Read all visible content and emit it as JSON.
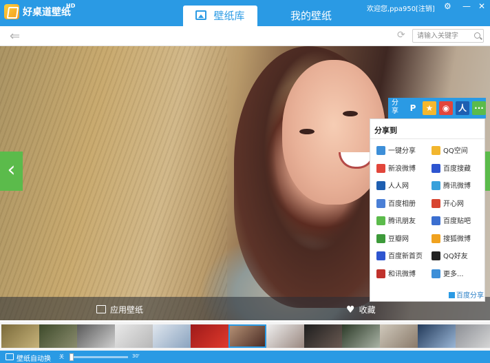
{
  "app": {
    "title": "好桌道壁纸",
    "badge": "HD",
    "welcome": "欢迎您,ppa950",
    "logout": "[注销]",
    "settings_icon": "gear-icon",
    "minimize_icon": "minimize-icon",
    "close_icon": "close-icon"
  },
  "tabs": [
    {
      "label": "壁纸库",
      "active": true,
      "icon": "picture-icon"
    },
    {
      "label": "我的壁纸",
      "active": false
    }
  ],
  "toolbar": {
    "back_icon": "arrow-left-icon",
    "refresh_icon": "refresh-icon",
    "search_placeholder": "请输入关键字",
    "search_icon": "search-icon"
  },
  "viewer": {
    "prev_icon": "chevron-left-icon",
    "apply_label": "应用壁纸",
    "favorite_label": "收藏"
  },
  "share": {
    "bar_label": "分享",
    "bar_icons": [
      {
        "name": "tencent-weibo-icon",
        "color": "#2a9ae4",
        "glyph": "P"
      },
      {
        "name": "qzone-icon",
        "color": "#f5b72d",
        "glyph": "★"
      },
      {
        "name": "sina-weibo-icon",
        "color": "#e2463b",
        "glyph": "◉"
      },
      {
        "name": "renren-icon",
        "color": "#1e5fb1",
        "glyph": "人"
      },
      {
        "name": "more-icon",
        "color": "#5bbb4b",
        "glyph": "···"
      }
    ],
    "panel_title": "分享到",
    "items": [
      {
        "label": "一键分享",
        "color": "#3d8fd8"
      },
      {
        "label": "QQ空间",
        "color": "#f2b62e"
      },
      {
        "label": "新浪微博",
        "color": "#e2463b"
      },
      {
        "label": "百度搜藏",
        "color": "#2e55d0"
      },
      {
        "label": "人人网",
        "color": "#1e5fb1"
      },
      {
        "label": "腾讯微博",
        "color": "#38a1db"
      },
      {
        "label": "百度相册",
        "color": "#4a7fd6"
      },
      {
        "label": "开心网",
        "color": "#d8442f"
      },
      {
        "label": "腾讯朋友",
        "color": "#5bbb4b"
      },
      {
        "label": "百度贴吧",
        "color": "#3b6fd0"
      },
      {
        "label": "豆瓣网",
        "color": "#3d9a3a"
      },
      {
        "label": "搜狐微博",
        "color": "#f0a21f"
      },
      {
        "label": "百度新首页",
        "color": "#2e55d0"
      },
      {
        "label": "QQ好友",
        "color": "#222222"
      },
      {
        "label": "和讯微博",
        "color": "#c0322c"
      },
      {
        "label": "更多...",
        "color": "#3d8fd8"
      }
    ],
    "footer": "百度分享"
  },
  "thumbnails": [
    {
      "colors": [
        "#7a6a3a",
        "#c7b37a"
      ]
    },
    {
      "colors": [
        "#3d4a2a",
        "#8b8c6e"
      ]
    },
    {
      "colors": [
        "#5a5a5a",
        "#cfcfcf"
      ]
    },
    {
      "colors": [
        "#e9e9e9",
        "#b7b7b7"
      ]
    },
    {
      "colors": [
        "#dfe6ee",
        "#8aa3bf"
      ]
    },
    {
      "colors": [
        "#9e1a1a",
        "#e03a2c"
      ]
    },
    {
      "colors": [
        "#b38f73",
        "#4a2c25"
      ]
    },
    {
      "colors": [
        "#efefef",
        "#9a8880"
      ]
    },
    {
      "colors": [
        "#1e1e1e",
        "#6a5a52"
      ]
    },
    {
      "colors": [
        "#2c3a28",
        "#a9b3a5"
      ]
    },
    {
      "colors": [
        "#cfc8bb",
        "#8a7a6a"
      ]
    },
    {
      "colors": [
        "#233a5a",
        "#9ab6d6"
      ]
    },
    {
      "colors": [
        "#8c8f95",
        "#d9d9d9"
      ]
    }
  ],
  "status": {
    "auto_icon": "monitor-icon",
    "auto_label": "壁纸自动换",
    "slider_min": "关",
    "slider_max": "30'",
    "slider_value": 0
  }
}
